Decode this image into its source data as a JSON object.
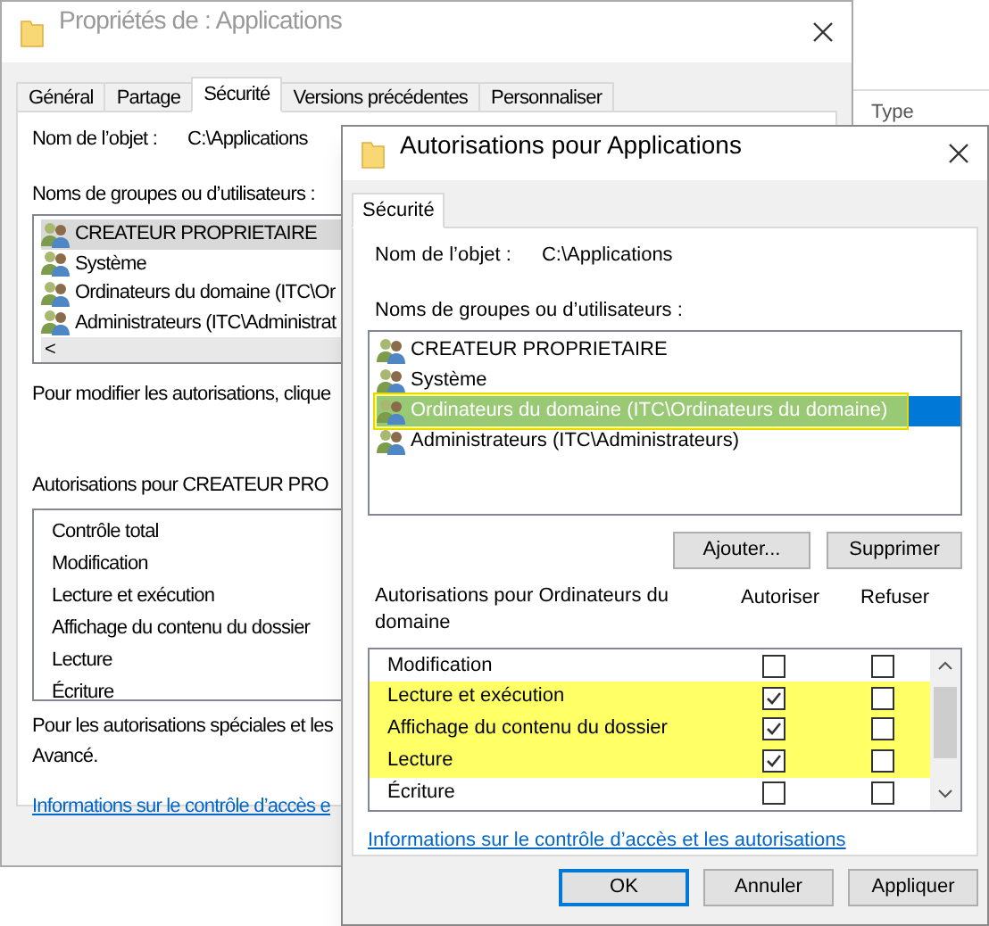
{
  "background_column_header": "Type",
  "properties_window": {
    "title": "Propriétés de : Applications",
    "tabs": [
      {
        "label": "Général",
        "selected": false
      },
      {
        "label": "Partage",
        "selected": false
      },
      {
        "label": "Sécurité",
        "selected": true
      },
      {
        "label": "Versions précédentes",
        "selected": false
      },
      {
        "label": "Personnaliser",
        "selected": false
      }
    ],
    "object_label": "Nom de l’objet :",
    "object_value": "C:\\Applications",
    "groups_label": "Noms de groupes ou d’utilisateurs :",
    "groups": [
      {
        "name": "CREATEUR PROPRIETAIRE",
        "selected": true
      },
      {
        "name": "Système",
        "selected": false
      },
      {
        "name": "Ordinateurs du domaine (ITC\\Or",
        "selected": false
      },
      {
        "name": "Administrateurs (ITC\\Administrat",
        "selected": false
      }
    ],
    "scroll_left": "<",
    "modify_hint": "Pour modifier les autorisations, clique",
    "permissions_label": "Autorisations pour CREATEUR PRO",
    "permissions": [
      "Contrôle total",
      "Modification",
      "Lecture et exécution",
      "Affichage du contenu du dossier",
      "Lecture",
      "Écriture"
    ],
    "special_hint": "Pour les autorisations spéciales et les",
    "special_hint_2": "Avancé.",
    "link": "Informations sur le contrôle d’accès e"
  },
  "permissions_window": {
    "title": "Autorisations pour Applications",
    "tabs": [
      {
        "label": "Sécurité",
        "selected": true
      }
    ],
    "object_label": "Nom de l’objet :",
    "object_value": "C:\\Applications",
    "groups_label": "Noms de groupes ou d’utilisateurs :",
    "groups": [
      {
        "name": "CREATEUR PROPRIETAIRE",
        "selected": false,
        "highlighted": false
      },
      {
        "name": "Système",
        "selected": false,
        "highlighted": false
      },
      {
        "name": "Ordinateurs du domaine (ITC\\Ordinateurs du domaine)",
        "selected": true,
        "highlighted": true
      },
      {
        "name": "Administrateurs (ITC\\Administrateurs)",
        "selected": false,
        "highlighted": false
      }
    ],
    "add_button": "Ajouter...",
    "remove_button": "Supprimer",
    "permissions_label": "Autorisations pour Ordinateurs du domaine",
    "allow_header": "Autoriser",
    "deny_header": "Refuser",
    "permissions": [
      {
        "name": "Modification",
        "allow": false,
        "deny": false,
        "highlighted": false
      },
      {
        "name": "Lecture et exécution",
        "allow": true,
        "deny": false,
        "highlighted": true
      },
      {
        "name": "Affichage du contenu du dossier",
        "allow": true,
        "deny": false,
        "highlighted": true
      },
      {
        "name": "Lecture",
        "allow": true,
        "deny": false,
        "highlighted": true
      },
      {
        "name": "Écriture",
        "allow": false,
        "deny": false,
        "highlighted": false
      }
    ],
    "link": "Informations sur le contrôle d’accès et les autorisations",
    "buttons": [
      "OK",
      "Annuler",
      "Appliquer"
    ]
  }
}
